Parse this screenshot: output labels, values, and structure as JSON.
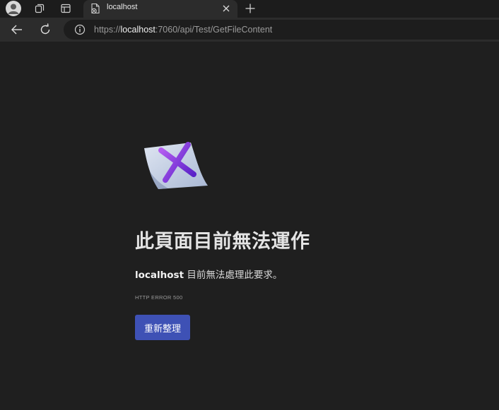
{
  "browser": {
    "tab": {
      "title": "localhost"
    },
    "address_bar": {
      "url_prefix": "https://",
      "url_host": "localhost",
      "url_suffix": ":7060/api/Test/GetFileContent"
    },
    "icons": {
      "profile": "avatar-icon",
      "workspaces": "workspaces-icon",
      "tab_actions": "tab-actions-icon",
      "favicon": "page-error-icon",
      "close": "close-icon",
      "new_tab": "plus-icon",
      "back": "back-arrow-icon",
      "refresh": "refresh-icon",
      "site_info": "info-icon"
    }
  },
  "error_page": {
    "heading": "此頁面目前無法運作",
    "message_host": "localhost",
    "message_text": " 目前無法處理此要求。",
    "error_code": "HTTP ERROR 500",
    "reload_button": "重新整理"
  },
  "colors": {
    "page_background": "#1f1f1f",
    "toolbar_background": "#2c2c2c",
    "button_accent": "#3e51b5",
    "heading_text": "#e4e4e4"
  }
}
